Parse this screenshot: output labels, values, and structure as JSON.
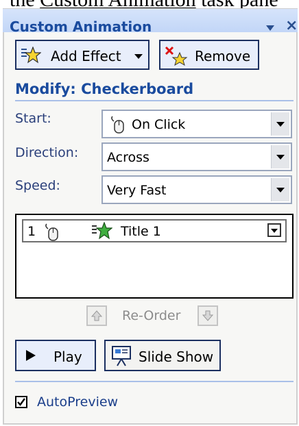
{
  "caption": {
    "before": "the ",
    "link": "Custom Animation",
    "after": " task pane"
  },
  "pane": {
    "title": "Custom Animation",
    "close_glyph": "×"
  },
  "toolbar": {
    "add_effect_label": "Add Effect",
    "remove_label": "Remove"
  },
  "modify": {
    "title": "Modify: Checkerboard",
    "start_label": "Start:",
    "start_value": "On Click",
    "direction_label": "Direction:",
    "direction_value": "Across",
    "speed_label": "Speed:",
    "speed_value": "Very Fast"
  },
  "animation_list": [
    {
      "number": "1",
      "trigger_icon": "mouse-icon",
      "effect_icon": "entrance-star-icon",
      "name": "Title 1"
    }
  ],
  "reorder": {
    "label": "Re-Order"
  },
  "playback": {
    "play_label": "Play",
    "slideshow_label": "Slide Show"
  },
  "autopreview": {
    "label": "AutoPreview",
    "checked": true
  },
  "colors": {
    "title_text": "#1a4b9e",
    "title_bar": "#c9dbf8",
    "button_border": "#1b2f60"
  }
}
